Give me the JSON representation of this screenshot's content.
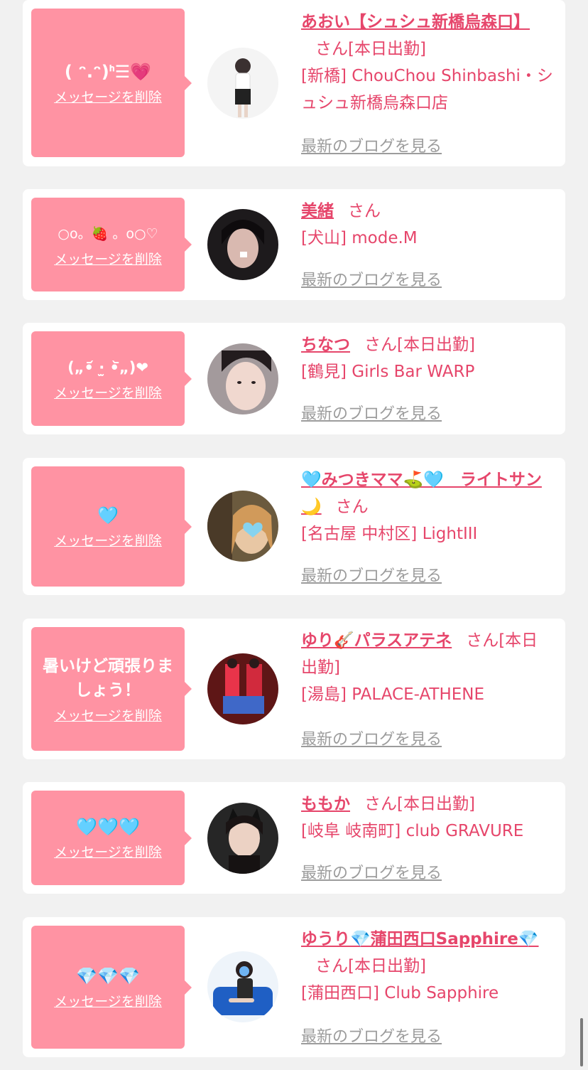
{
  "delete_label": "メッセージを削除",
  "blog_label": "最新のブログを見る",
  "san": "さん",
  "colors": {
    "accent": "#e6466b",
    "bubble": "#ff93a3",
    "muted": "#9c9c9c",
    "background": "#f1f1f1"
  },
  "items": [
    {
      "message": "( ᵔ.ᵔ)ᑋ☰💗",
      "name": "あおい【シュシュ新橋烏森口】",
      "status": "[本日出勤]",
      "shop": "[新橋] ChouChou Shinbashi・シュシュ新橋烏森口店",
      "avatar_icon": "photo-portrait-standing"
    },
    {
      "message": "○o。🍓 。o○♡",
      "name": "美緒",
      "status": "",
      "shop": "[犬山] mode.M",
      "avatar_icon": "photo-portrait-dark-hair"
    },
    {
      "message": "(„•᷄ ·̫ •᷅„)❤",
      "name": "ちなつ",
      "status": "[本日出勤]",
      "shop": "[鶴見] Girls Bar WARP",
      "avatar_icon": "photo-portrait-closeup"
    },
    {
      "message": "🩵",
      "name": "🩵みつきママ⛳🩵　ライトサン🌙",
      "status": "",
      "shop": "[名古屋 中村区] LightIII",
      "avatar_icon": "photo-portrait-heart-sticker"
    },
    {
      "message": "暑いけど頑張りましょう！",
      "name": "ゆり🎸パラスアテネ",
      "status": "[本日出勤]",
      "shop": "[湯島] PALACE-ATHENE",
      "avatar_icon": "photo-portrait-costume"
    },
    {
      "message": "🩵🩵🩵",
      "name": "ももか",
      "status": "[本日出勤]",
      "shop": "[岐阜 岐南町] club GRAVURE",
      "avatar_icon": "photo-portrait-cat-ears"
    },
    {
      "message": "💎💎💎",
      "name": "ゆうり💎蒲田西口Sapphire💎",
      "status": "[本日出勤]",
      "shop": "[蒲田西口] Club Sapphire",
      "avatar_icon": "photo-portrait-blue-sofa"
    }
  ]
}
